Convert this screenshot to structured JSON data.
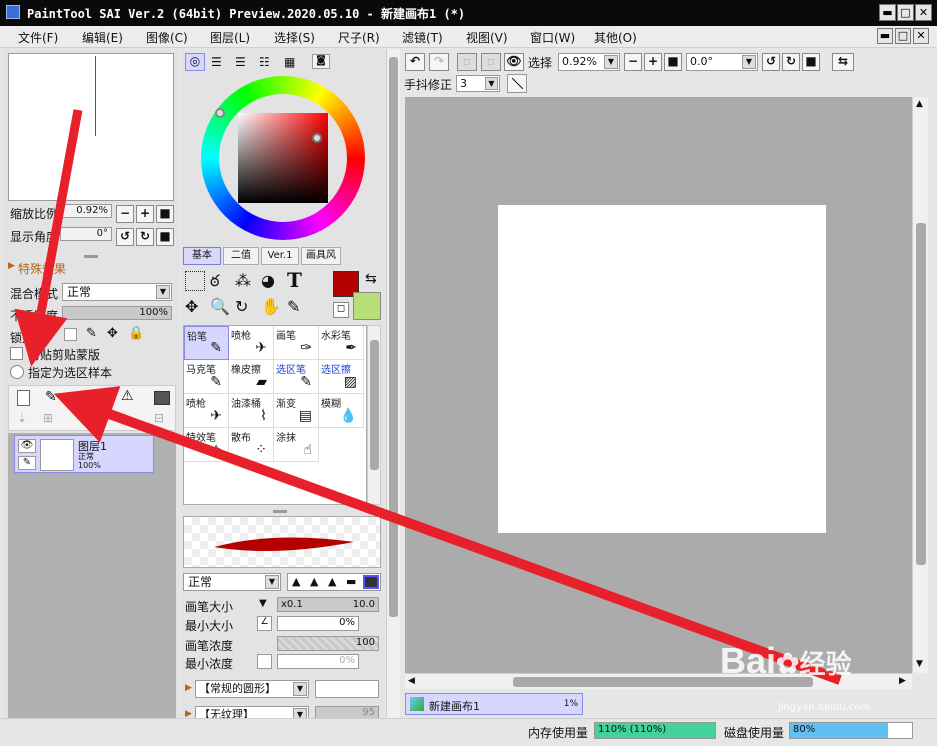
{
  "window": {
    "title": "PaintTool SAI Ver.2 (64bit) Preview.2020.05.10 - 新建画布1 (*)",
    "minimize": "▬",
    "maximize": "□",
    "close": "✕"
  },
  "menu": [
    "文件(F)",
    "编辑(E)",
    "图像(C)",
    "图层(L)",
    "选择(S)",
    "尺子(R)",
    "滤镜(T)",
    "视图(V)",
    "窗口(W)",
    "其他(O)"
  ],
  "navigator": {
    "zoom_label": "缩放比例",
    "zoom_value": "0.92%",
    "angle_label": "显示角度",
    "angle_value": "0°"
  },
  "layer_props": {
    "section_title": "特殊效果",
    "blend_label": "混合模式",
    "blend_value": "正常",
    "opacity_label": "不透明度",
    "opacity_value": "100%",
    "opacity_fraction": 1.0,
    "lock_label": "锁定",
    "clip_label": "剪贴蒙版",
    "clip_prefix": "剪贴",
    "sample_label": "指定为选区样本"
  },
  "layers": [
    {
      "name": "图层1",
      "mode": "正常",
      "opacity": "100%"
    }
  ],
  "color_tabs": [
    "基本",
    "二值",
    "Ver.1",
    "画具风"
  ],
  "colors": {
    "primary": "#b50000",
    "secondary": "#b8e07a",
    "accent_select": "#d6d6ff",
    "mem_bar": "#42d39a",
    "disk_bar": "#5fc0f2"
  },
  "tools": [
    {
      "name": "铅笔",
      "icon": "pencil-icon",
      "glyph": "✎",
      "selected": true,
      "blue": false
    },
    {
      "name": "喷枪",
      "icon": "airbrush-icon",
      "glyph": "✈",
      "selected": false,
      "blue": false
    },
    {
      "name": "画笔",
      "icon": "brush-icon",
      "glyph": "✑",
      "selected": false,
      "blue": false
    },
    {
      "name": "水彩笔",
      "icon": "watercolor-icon",
      "glyph": "✒",
      "selected": false,
      "blue": false
    },
    {
      "name": "马克笔",
      "icon": "marker-icon",
      "glyph": "✎",
      "selected": false,
      "blue": false
    },
    {
      "name": "橡皮擦",
      "icon": "eraser-icon",
      "glyph": "▰",
      "selected": false,
      "blue": false
    },
    {
      "name": "选区笔",
      "icon": "selpen-icon",
      "glyph": "✎",
      "selected": false,
      "blue": true
    },
    {
      "name": "选区擦",
      "icon": "selerase-icon",
      "glyph": "▨",
      "selected": false,
      "blue": true
    },
    {
      "name": "喷枪",
      "icon": "airbrush2-icon",
      "glyph": "✈",
      "selected": false,
      "blue": false
    },
    {
      "name": "油漆桶",
      "icon": "bucket-icon",
      "glyph": "⌇",
      "selected": false,
      "blue": false
    },
    {
      "name": "渐变",
      "icon": "gradient-icon",
      "glyph": "▤",
      "selected": false,
      "blue": false
    },
    {
      "name": "模糊",
      "icon": "blur-icon",
      "glyph": "💧",
      "selected": false,
      "blue": false
    },
    {
      "name": "特效笔",
      "icon": "fxpen-icon",
      "glyph": "✧",
      "selected": false,
      "blue": false
    },
    {
      "name": "散布",
      "icon": "scatter-icon",
      "glyph": "⁘",
      "selected": false,
      "blue": false
    },
    {
      "name": "涂抹",
      "icon": "smudge-icon",
      "glyph": "☝",
      "selected": false,
      "blue": false
    }
  ],
  "brush": {
    "blend_mode": "正常",
    "size_label": "画笔大小",
    "size_mult": "x0.1",
    "size_value": "10.0",
    "min_size_label": "最小大小",
    "min_size_value": "0%",
    "density_label": "画笔浓度",
    "density_value": "100",
    "min_density_label": "最小浓度",
    "min_density_value": "0%",
    "shape_label": "【常规的圆形】",
    "texture_label": "【无纹理】",
    "texture_value": "95"
  },
  "canvas_toolbar": {
    "select_label": "选择",
    "zoom": "0.92%",
    "angle": "0.0°",
    "stabilizer_label": "手抖修正",
    "stabilizer_value": "3"
  },
  "canvas_tab": {
    "name": "新建画布1",
    "zoom": "1%"
  },
  "status": {
    "mem_label": "内存使用量",
    "mem_value": "110% (110%)",
    "mem_fraction": 1.0,
    "disk_label": "磁盘使用量",
    "disk_value": "80%",
    "disk_fraction": 0.8
  },
  "watermark": {
    "brand": "Bai",
    "suffix": "经验",
    "url": "jingyan.baidu.com"
  }
}
